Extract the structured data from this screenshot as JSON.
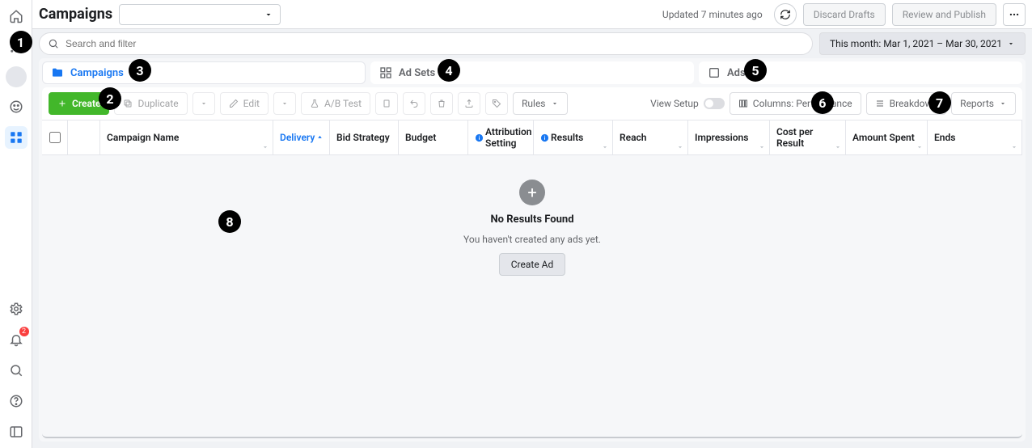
{
  "header": {
    "title": "Campaigns",
    "updated_text": "Updated 7 minutes ago",
    "discard_label": "Discard Drafts",
    "review_label": "Review and Publish"
  },
  "search": {
    "placeholder": "Search and filter"
  },
  "date_range": {
    "label": "This month: Mar 1, 2021 – Mar 30, 2021"
  },
  "tabs": {
    "campaigns": "Campaigns",
    "adsets": "Ad Sets",
    "ads": "Ads"
  },
  "toolbar": {
    "create": "Create",
    "duplicate": "Duplicate",
    "edit": "Edit",
    "abtest": "A/B Test",
    "rules": "Rules",
    "view_setup": "View Setup",
    "columns": "Columns: Performance",
    "breakdown": "Breakdown",
    "reports": "Reports"
  },
  "columns": {
    "name": "Campaign Name",
    "delivery": "Delivery",
    "bid": "Bid Strategy",
    "budget": "Budget",
    "attr": "Attribution Setting",
    "results": "Results",
    "reach": "Reach",
    "impressions": "Impressions",
    "cpr": "Cost per Result",
    "spent": "Amount Spent",
    "ends": "Ends"
  },
  "empty": {
    "title": "No Results Found",
    "subtitle": "You haven't created any ads yet.",
    "cta": "Create Ad"
  },
  "left_rail": {
    "notif_count": "2"
  },
  "markers": [
    "1",
    "2",
    "3",
    "4",
    "5",
    "6",
    "7",
    "8"
  ]
}
